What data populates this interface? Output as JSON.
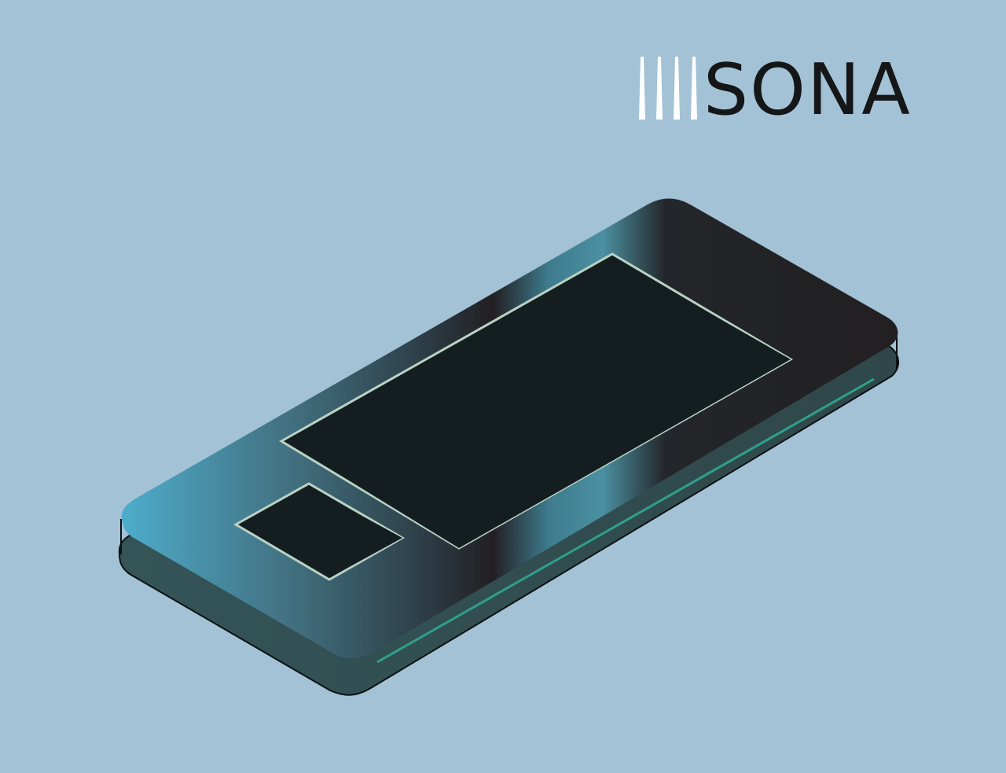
{
  "logo": {
    "wordmark": "SONA",
    "mark_icon": "four-vertical-spikes-icon",
    "text_color": "#141617"
  },
  "illustration": {
    "subject": "isometric-phone-device-icon",
    "background_color": "#a3c2d5",
    "body_colors": [
      "#4ba9c8",
      "#446b78",
      "#2a3b43",
      "#221f21"
    ],
    "screen_color": "#141e20",
    "accent_line_color": "#2fa08c"
  }
}
